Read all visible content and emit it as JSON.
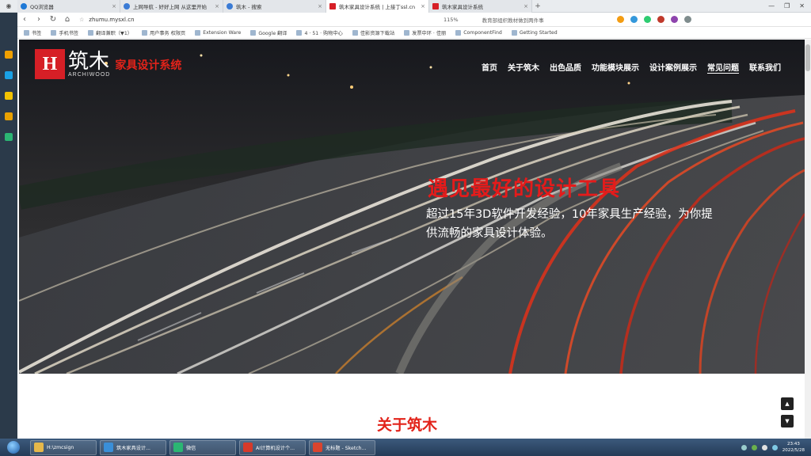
{
  "browser": {
    "tabs": [
      {
        "title": "QQ浏览器",
        "fav": "q",
        "active": false
      },
      {
        "title": "上网导航 - 好好上网 从这里开始",
        "fav": "blue",
        "active": false
      },
      {
        "title": "筑木 - 搜索",
        "fav": "blue",
        "active": false
      },
      {
        "title": "筑木家具设计系统 | 上接丁ssl.cn",
        "fav": "red",
        "active": true
      },
      {
        "title": "筑木家具设计系统",
        "fav": "red",
        "active": false
      }
    ],
    "url": "zhumu.mysxl.cn",
    "zoom": "115%",
    "search_hint": "教育部组织教材做到两件事",
    "bookmarks": [
      "书签",
      "手机书签",
      "翻译兼职（▼1）",
      "用户事务 权限页",
      "Extension Ware",
      "Google 翻译",
      "4 · 51 · 购物中心",
      "佳影资源下载站",
      "发票中环 · 佳丽",
      "ComponentFind",
      "Getting Started"
    ]
  },
  "site": {
    "logo_mark": "H",
    "logo_cn": "筑木",
    "logo_en": "ARCHIWOOD",
    "logo_system": "家具设计系统",
    "nav": [
      "首页",
      "关于筑木",
      "出色品质",
      "功能模块展示",
      "设计案例展示",
      "常见问题",
      "联系我们"
    ],
    "nav_current_index": 5,
    "hero_title": "遇见最好的设计工具",
    "hero_subtitle": "超过15年3D软件开发经验，10年家具生产经验，为你提供流畅的家具设计体验。",
    "section_title": "关于筑木",
    "scroll_up": "▲",
    "scroll_down": "▼"
  },
  "taskbar": {
    "items": [
      "H:\\zmcsign",
      "筑木家具设计...",
      "微信",
      "AI计算机设计个...",
      "无标题 - Sketch..."
    ],
    "time": "23:43",
    "date": "2022/5/28"
  }
}
